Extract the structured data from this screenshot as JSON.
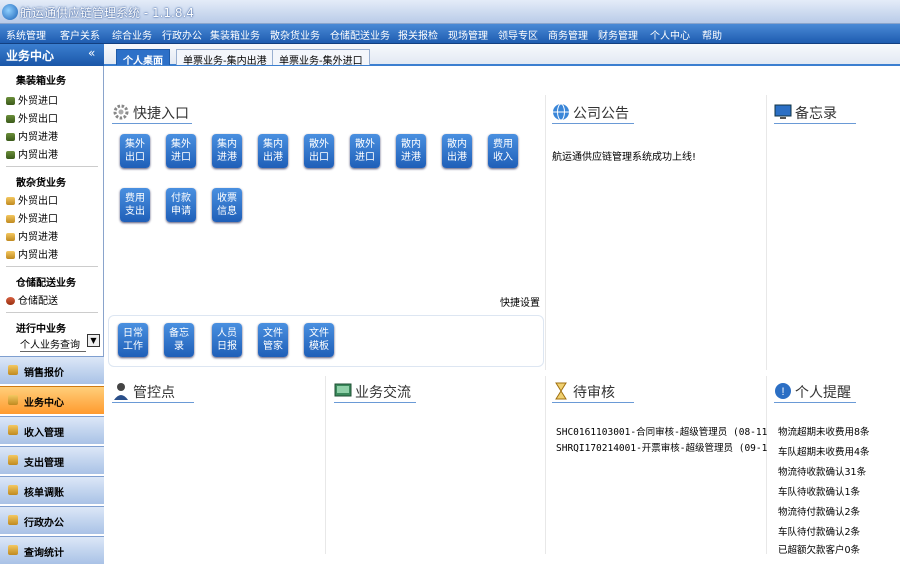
{
  "window": {
    "title": "航运通供应链管理系统 - 1.1.8.4"
  },
  "menu": [
    "系统管理",
    "客户关系",
    "综合业务",
    "行政办公",
    "集装箱业务",
    "散杂货业务",
    "仓储配送业务",
    "报关报检",
    "现场管理",
    "领导专区",
    "商务管理",
    "财务管理",
    "个人中心",
    "帮助"
  ],
  "sidebar": {
    "header": "业务中心",
    "collapse": "«",
    "sections": [
      {
        "title": "集装箱业务",
        "items": [
          "外贸进口",
          "外贸出口",
          "内贸进港",
          "内贸出港"
        ]
      },
      {
        "title": "散杂货业务",
        "items": [
          "外贸出口",
          "外贸进口",
          "内贸进港",
          "内贸出港"
        ]
      },
      {
        "title": "仓储配送业务",
        "items": [
          "仓储配送"
        ]
      },
      {
        "title": "进行中业务",
        "items": []
      }
    ],
    "select_value": "个人业务查询",
    "nav": [
      "销售报价",
      "业务中心",
      "收入管理",
      "支出管理",
      "核单调账",
      "行政办公",
      "查询统计"
    ]
  },
  "tabs": [
    "个人桌面",
    "单票业务-集内出港",
    "单票业务-集外进口"
  ],
  "quick": {
    "title": "快捷入口",
    "buttons": [
      [
        "集外",
        "出口"
      ],
      [
        "集外",
        "进口"
      ],
      [
        "集内",
        "进港"
      ],
      [
        "集内",
        "出港"
      ],
      [
        "散外",
        "出口"
      ],
      [
        "散外",
        "进口"
      ],
      [
        "散内",
        "进港"
      ],
      [
        "散内",
        "出港"
      ],
      [
        "费用",
        "收入"
      ],
      [
        "费用",
        "支出"
      ],
      [
        "付款",
        "申请"
      ],
      [
        "收票",
        "信息"
      ]
    ],
    "settings": "快捷设置",
    "tools": [
      [
        "日常",
        "工作"
      ],
      [
        "备忘",
        "录"
      ],
      [
        "人员",
        "日报"
      ],
      [
        "文件",
        "管家"
      ],
      [
        "文件",
        "模板"
      ]
    ]
  },
  "announce": {
    "title": "公司公告",
    "text": "航运通供应链管理系统成功上线!"
  },
  "memo": {
    "title": "备忘录"
  },
  "control": {
    "title": "管控点"
  },
  "exchange": {
    "title": "业务交流"
  },
  "audit": {
    "title": "待审核",
    "rows": [
      "SHC0161103001-合同审核-超级管理员 (08-11",
      "SHRQI170214001-开票审核-超级管理员 (09-1"
    ]
  },
  "remind": {
    "title": "个人提醒",
    "rows": [
      "物流超期未收费用8条",
      "车队超期未收费用4条",
      "物流待收款确认31条",
      "车队待收款确认1条",
      "物流待付款确认2条",
      "车队待付款确认2条",
      "已超额欠款客户0条"
    ]
  },
  "colors": {
    "menubar": "#1e5cb0",
    "accent": "#2d70c8",
    "active_nav": "#ff9a2e"
  }
}
